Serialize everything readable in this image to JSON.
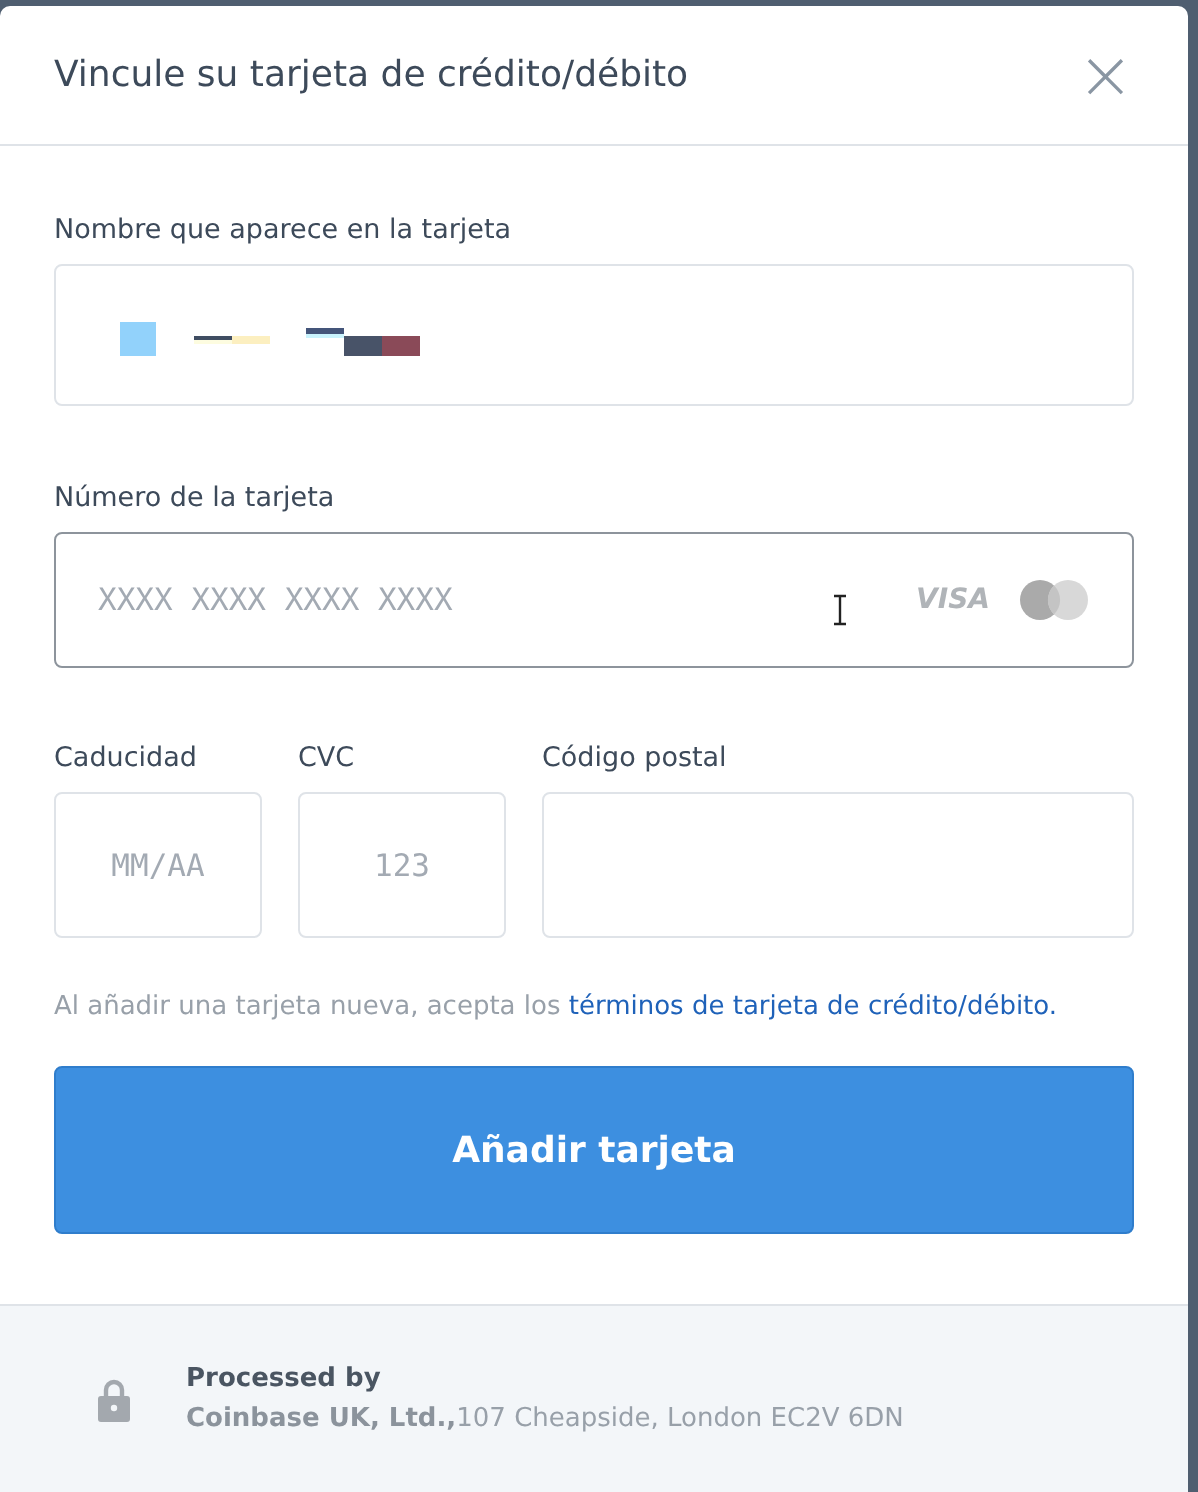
{
  "dialog": {
    "title": "Vincule su tarjeta de crédito/débito",
    "close": "×"
  },
  "fields": [
    {
      "kind": "name",
      "label": "Nombre que aparece en la tarjeta",
      "focused": false
    },
    {
      "kind": "number",
      "label": "Número de la tarjeta",
      "placeholder": "XXXX XXXX XXXX XXXX",
      "focused": true,
      "brand": "VISA"
    }
  ],
  "row_fields": [
    {
      "label": "Caducidad",
      "placeholder": "MM/AA"
    },
    {
      "label": "CVC",
      "placeholder": "123"
    },
    {
      "label": "Código postal"
    }
  ],
  "terms": {
    "text": "Al añadir una tarjeta nueva, acepta los",
    "link": "términos de tarjeta de crédito/débito."
  },
  "submit": "Añadir tarjeta",
  "footer": {
    "heading": "Processed by",
    "company": "Coinbase UK, Ltd.,",
    "address": "107 Cheapside, London EC2V 6DN"
  }
}
